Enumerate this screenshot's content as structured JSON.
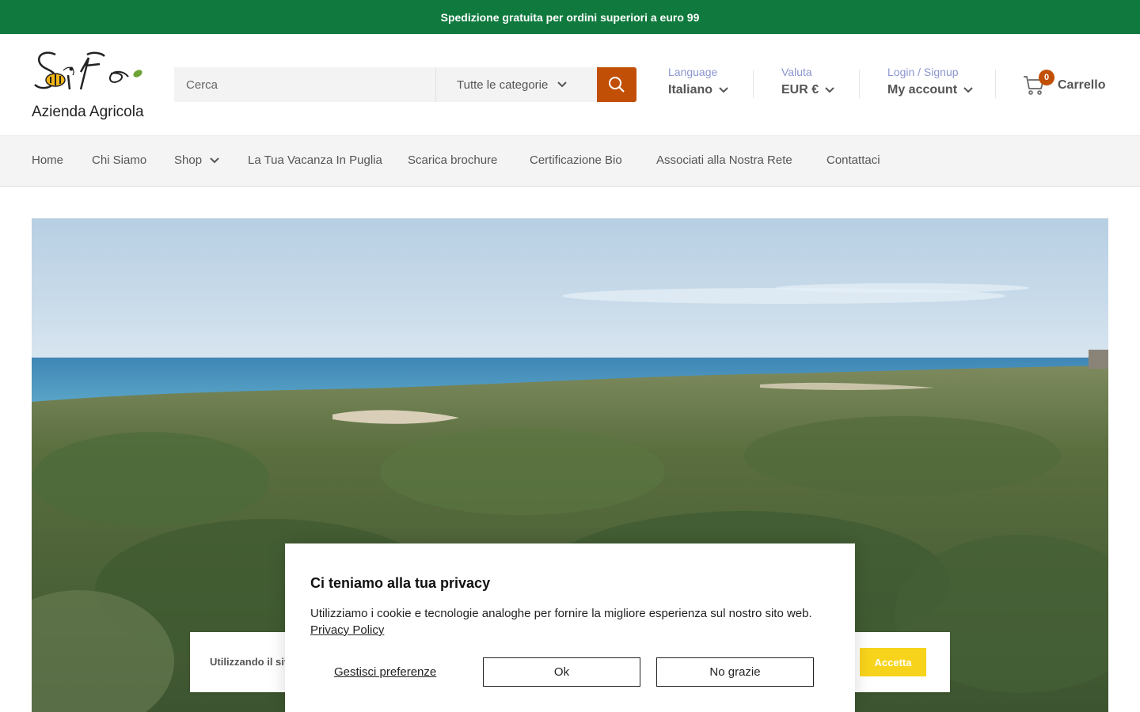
{
  "announcement": {
    "text": "Spedizione gratuita per ordini superiori a euro 99"
  },
  "logo": {
    "text": "Azienda Agricola",
    "wordmark": "SiFè"
  },
  "search": {
    "placeholder": "Cerca",
    "category": "Tutte le categorie",
    "icon": "search-icon"
  },
  "header": {
    "language": {
      "label": "Language",
      "value": "Italiano"
    },
    "currency": {
      "label": "Valuta",
      "value": "EUR €"
    },
    "account": {
      "label": "Login / Signup",
      "value": "My account"
    },
    "cart": {
      "count": "0",
      "label": "Carrello",
      "icon": "cart-icon"
    }
  },
  "nav": {
    "items": [
      {
        "label": "Home"
      },
      {
        "label": "Chi Siamo"
      },
      {
        "label": "Shop"
      },
      {
        "label": "La Tua Vacanza In Puglia"
      },
      {
        "label": "Scarica brochure"
      },
      {
        "label": "Certificazione Bio"
      },
      {
        "label": "Associati alla Nostra Rete"
      },
      {
        "label": "Contattaci"
      }
    ]
  },
  "cookie_bar": {
    "text": "Utilizzando il sito",
    "accept_label": "Accetta"
  },
  "privacy_modal": {
    "title": "Ci teniamo alla tua privacy",
    "body": "Utilizziamo i cookie e tecnologie analoghe per fornire la migliore esperienza sul nostro sito web.",
    "link": "Privacy Policy",
    "manage_label": "Gestisci preferenze",
    "ok_label": "Ok",
    "decline_label": "No grazie"
  },
  "colors": {
    "green": "#107a3e",
    "orange": "#c15006",
    "accent_blue": "#8b95cf",
    "yellow": "#f7d31b"
  }
}
